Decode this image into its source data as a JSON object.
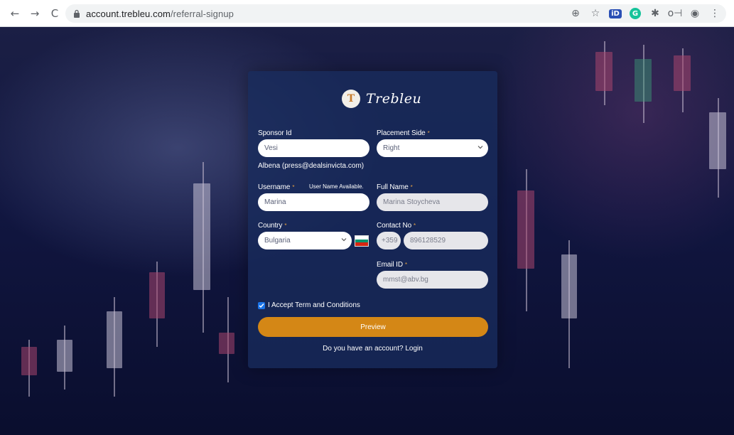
{
  "browser": {
    "back_icon": "←",
    "forward_icon": "→",
    "reload_icon": "C",
    "url_host": "account.trebleu.com",
    "url_path": "/referral-signup",
    "zoom_icon": "⊕",
    "star_icon": "☆",
    "ext_id_label": "iD",
    "ext_g_label": "G",
    "puzzle_icon": "✱",
    "key_icon": "o⊣",
    "profile_icon": "◉",
    "menu_icon": "⋮"
  },
  "brand": {
    "logo_initial": "T",
    "name": "Trebleu"
  },
  "form": {
    "sponsor_label": "Sponsor Id",
    "sponsor_value": "Vesi",
    "sponsor_info": "Albena (press@dealsinvicta.com)",
    "placement_label": "Placement Side",
    "placement_value": "Right",
    "username_label": "Username",
    "username_status": "User Name Available.",
    "username_value": "Marina",
    "fullname_label": "Full Name",
    "fullname_value": "Marina Stoycheva",
    "country_label": "Country",
    "country_value": "Bulgaria",
    "contact_label": "Contact No",
    "dial_code": "+359",
    "phone_value": "896128529",
    "email_label": "Email ID",
    "email_value": "mmst@abv.bg",
    "terms_label": "I Accept Term and Conditions",
    "preview_button": "Preview",
    "login_prompt": "Do you have an account? Login"
  },
  "colors": {
    "accent": "#d48716",
    "card": "#182c5c",
    "flag_white": "#ffffff",
    "flag_green": "#00966e",
    "flag_red": "#d62612"
  }
}
